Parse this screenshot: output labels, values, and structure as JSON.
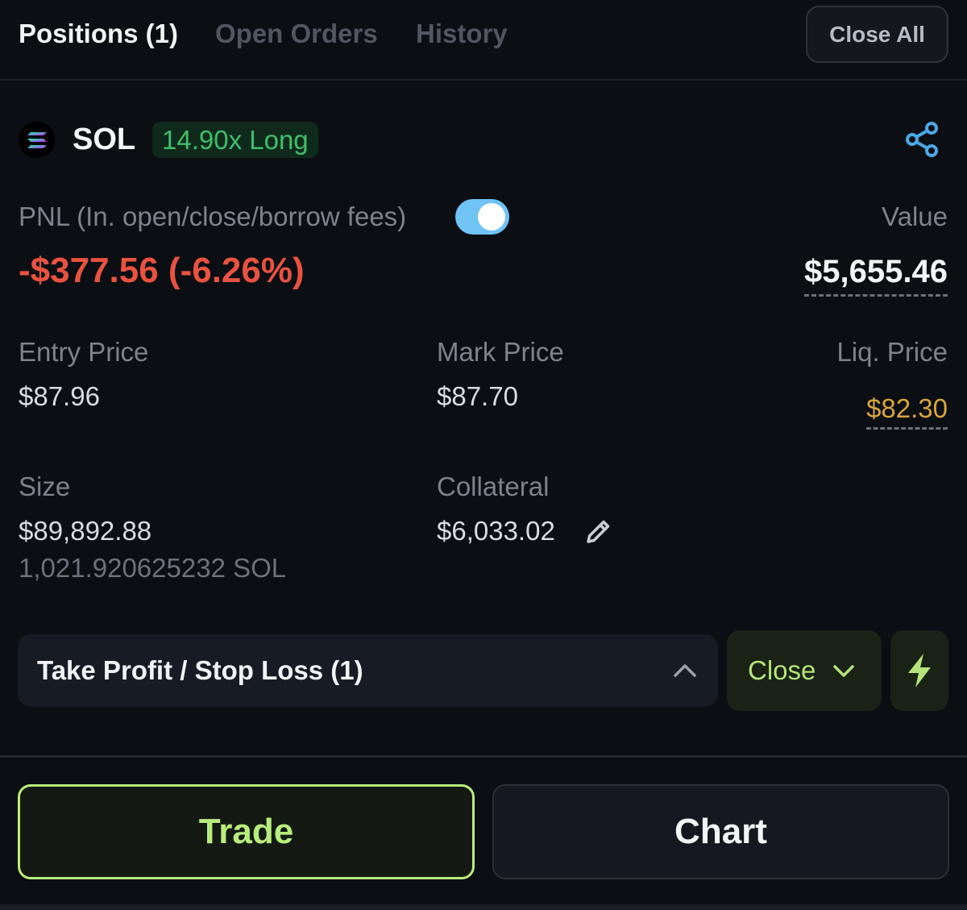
{
  "tabs": [
    {
      "label": "Positions (1)",
      "active": true
    },
    {
      "label": "Open Orders",
      "active": false
    },
    {
      "label": "History",
      "active": false
    }
  ],
  "header": {
    "close_all_label": "Close All"
  },
  "position": {
    "coin": "SOL",
    "coin_icon": "solana-icon",
    "leverage_badge": "14.90x Long",
    "pnl_label": "PNL (In. open/close/borrow fees)",
    "pnl_toggle_on": true,
    "pnl_value": "-$377.56 (-6.26%)",
    "value_label": "Value",
    "value_amount": "$5,655.46",
    "entry_price_label": "Entry Price",
    "entry_price": "$87.96",
    "mark_price_label": "Mark Price",
    "mark_price": "$87.70",
    "liq_price_label": "Liq. Price",
    "liq_price": "$82.30",
    "size_label": "Size",
    "size_usd": "$89,892.88",
    "size_token": "1,021.920625232 SOL",
    "collateral_label": "Collateral",
    "collateral": "$6,033.02"
  },
  "actions": {
    "tpsl_label": "Take Profit / Stop Loss (1)",
    "close_label": "Close",
    "trade_label": "Trade",
    "chart_label": "Chart"
  },
  "colors": {
    "background": "#0b0e12",
    "pnl_negative": "#e8523f",
    "long_badge": "#3fbf6a",
    "liq_price": "#d9a53b",
    "accent_green": "#b8ed7d",
    "toggle_blue": "#6fc3f5",
    "share_blue": "#4aa8e8"
  }
}
